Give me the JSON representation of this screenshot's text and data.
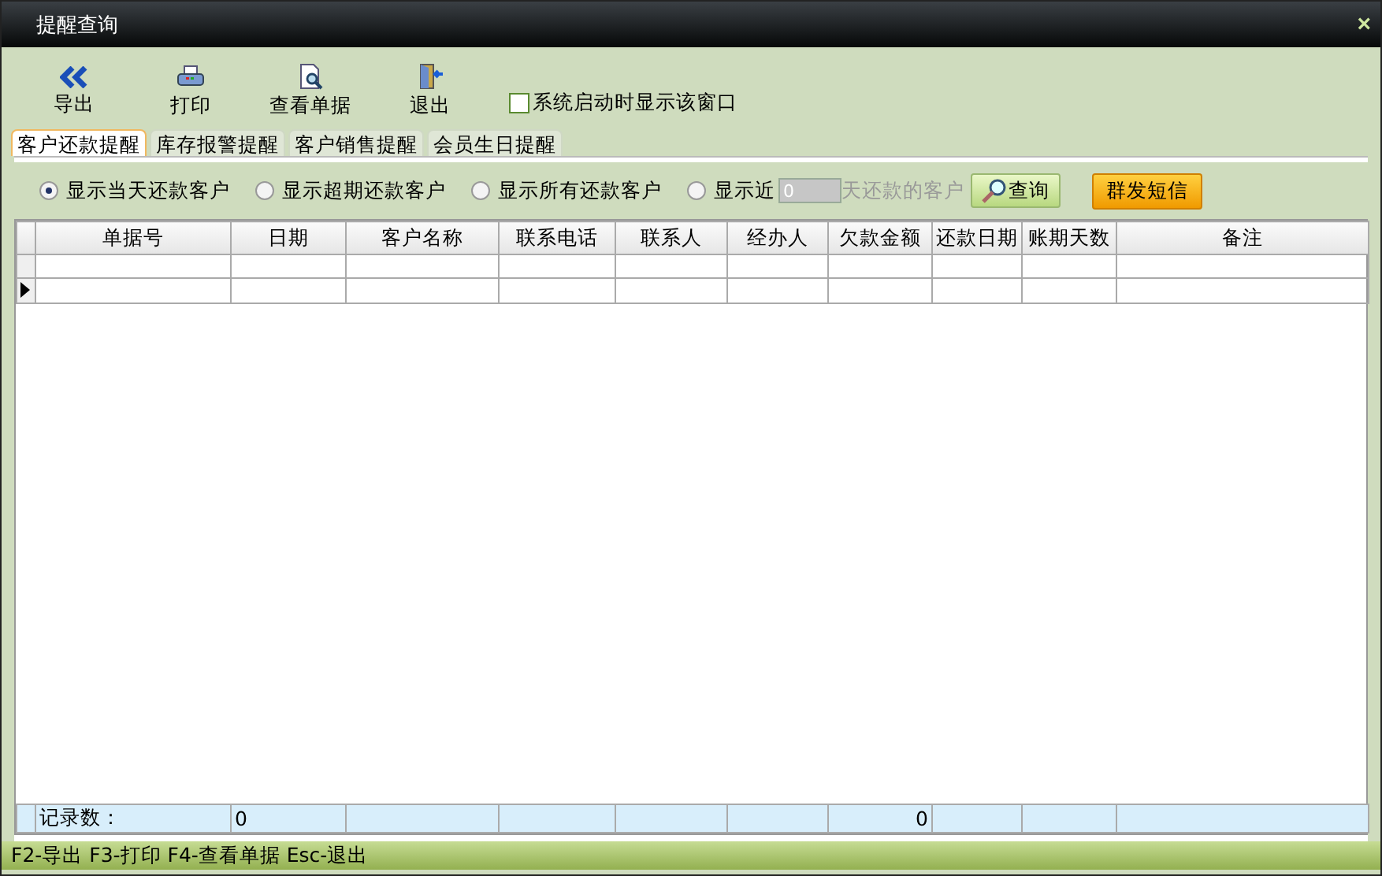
{
  "window": {
    "title": "提醒查询",
    "close": "×"
  },
  "toolbar": [
    {
      "kind": "export",
      "label": "导出"
    },
    {
      "kind": "print",
      "label": "打印"
    },
    {
      "kind": "view",
      "label": "查看单据"
    },
    {
      "kind": "exit",
      "label": "退出"
    }
  ],
  "startup_checkbox": {
    "label": "系统启动时显示该窗口",
    "checked": false
  },
  "tabs": [
    {
      "label": "客户还款提醒",
      "selected": true
    },
    {
      "label": "库存报警提醒",
      "selected": false
    },
    {
      "label": "客户销售提醒",
      "selected": false
    },
    {
      "label": "会员生日提醒",
      "selected": false
    }
  ],
  "filters": [
    {
      "label": "显示当天还款客户",
      "selected": true
    },
    {
      "label": "显示超期还款客户",
      "selected": false
    },
    {
      "label": "显示所有还款客户",
      "selected": false
    },
    {
      "label": "显示近",
      "selected": false
    }
  ],
  "days_field": {
    "value": "0",
    "disabled": true,
    "suffix": "天还款的客户"
  },
  "query_button": "查询",
  "sms_button": "群发短信",
  "table": {
    "columns": [
      "单据号",
      "日期",
      "客户名称",
      "联系电话",
      "联系人",
      "经办人",
      "欠款金额",
      "还款日期",
      "账期天数",
      "备注"
    ],
    "rows": [
      {
        "current": false
      },
      {
        "current": true
      }
    ],
    "footer": {
      "label": "记录数：",
      "date_count": "0",
      "amount_total": "0"
    }
  },
  "status_bar": "F2-导出 F3-打印 F4-查看单据 Esc-退出"
}
